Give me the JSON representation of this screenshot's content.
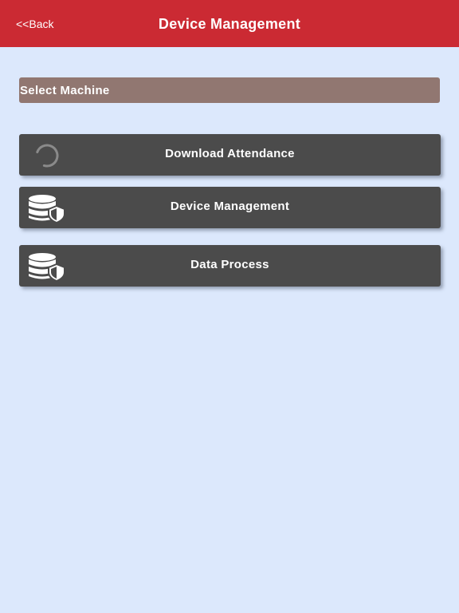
{
  "header": {
    "back_label": "<<Back",
    "title": "Device Management",
    "background_color": "#cb2a33"
  },
  "machine_select": {
    "label": "Select Machine",
    "background_color": "#917771"
  },
  "actions": [
    {
      "label": "Download Attendance",
      "icon": "loading-spinner-icon"
    },
    {
      "label": "Device Management",
      "icon": "database-shield-icon"
    },
    {
      "label": "Data Process",
      "icon": "database-shield-icon"
    }
  ],
  "colors": {
    "page_background": "#dce8fc",
    "button_background": "#4b4b4b"
  }
}
